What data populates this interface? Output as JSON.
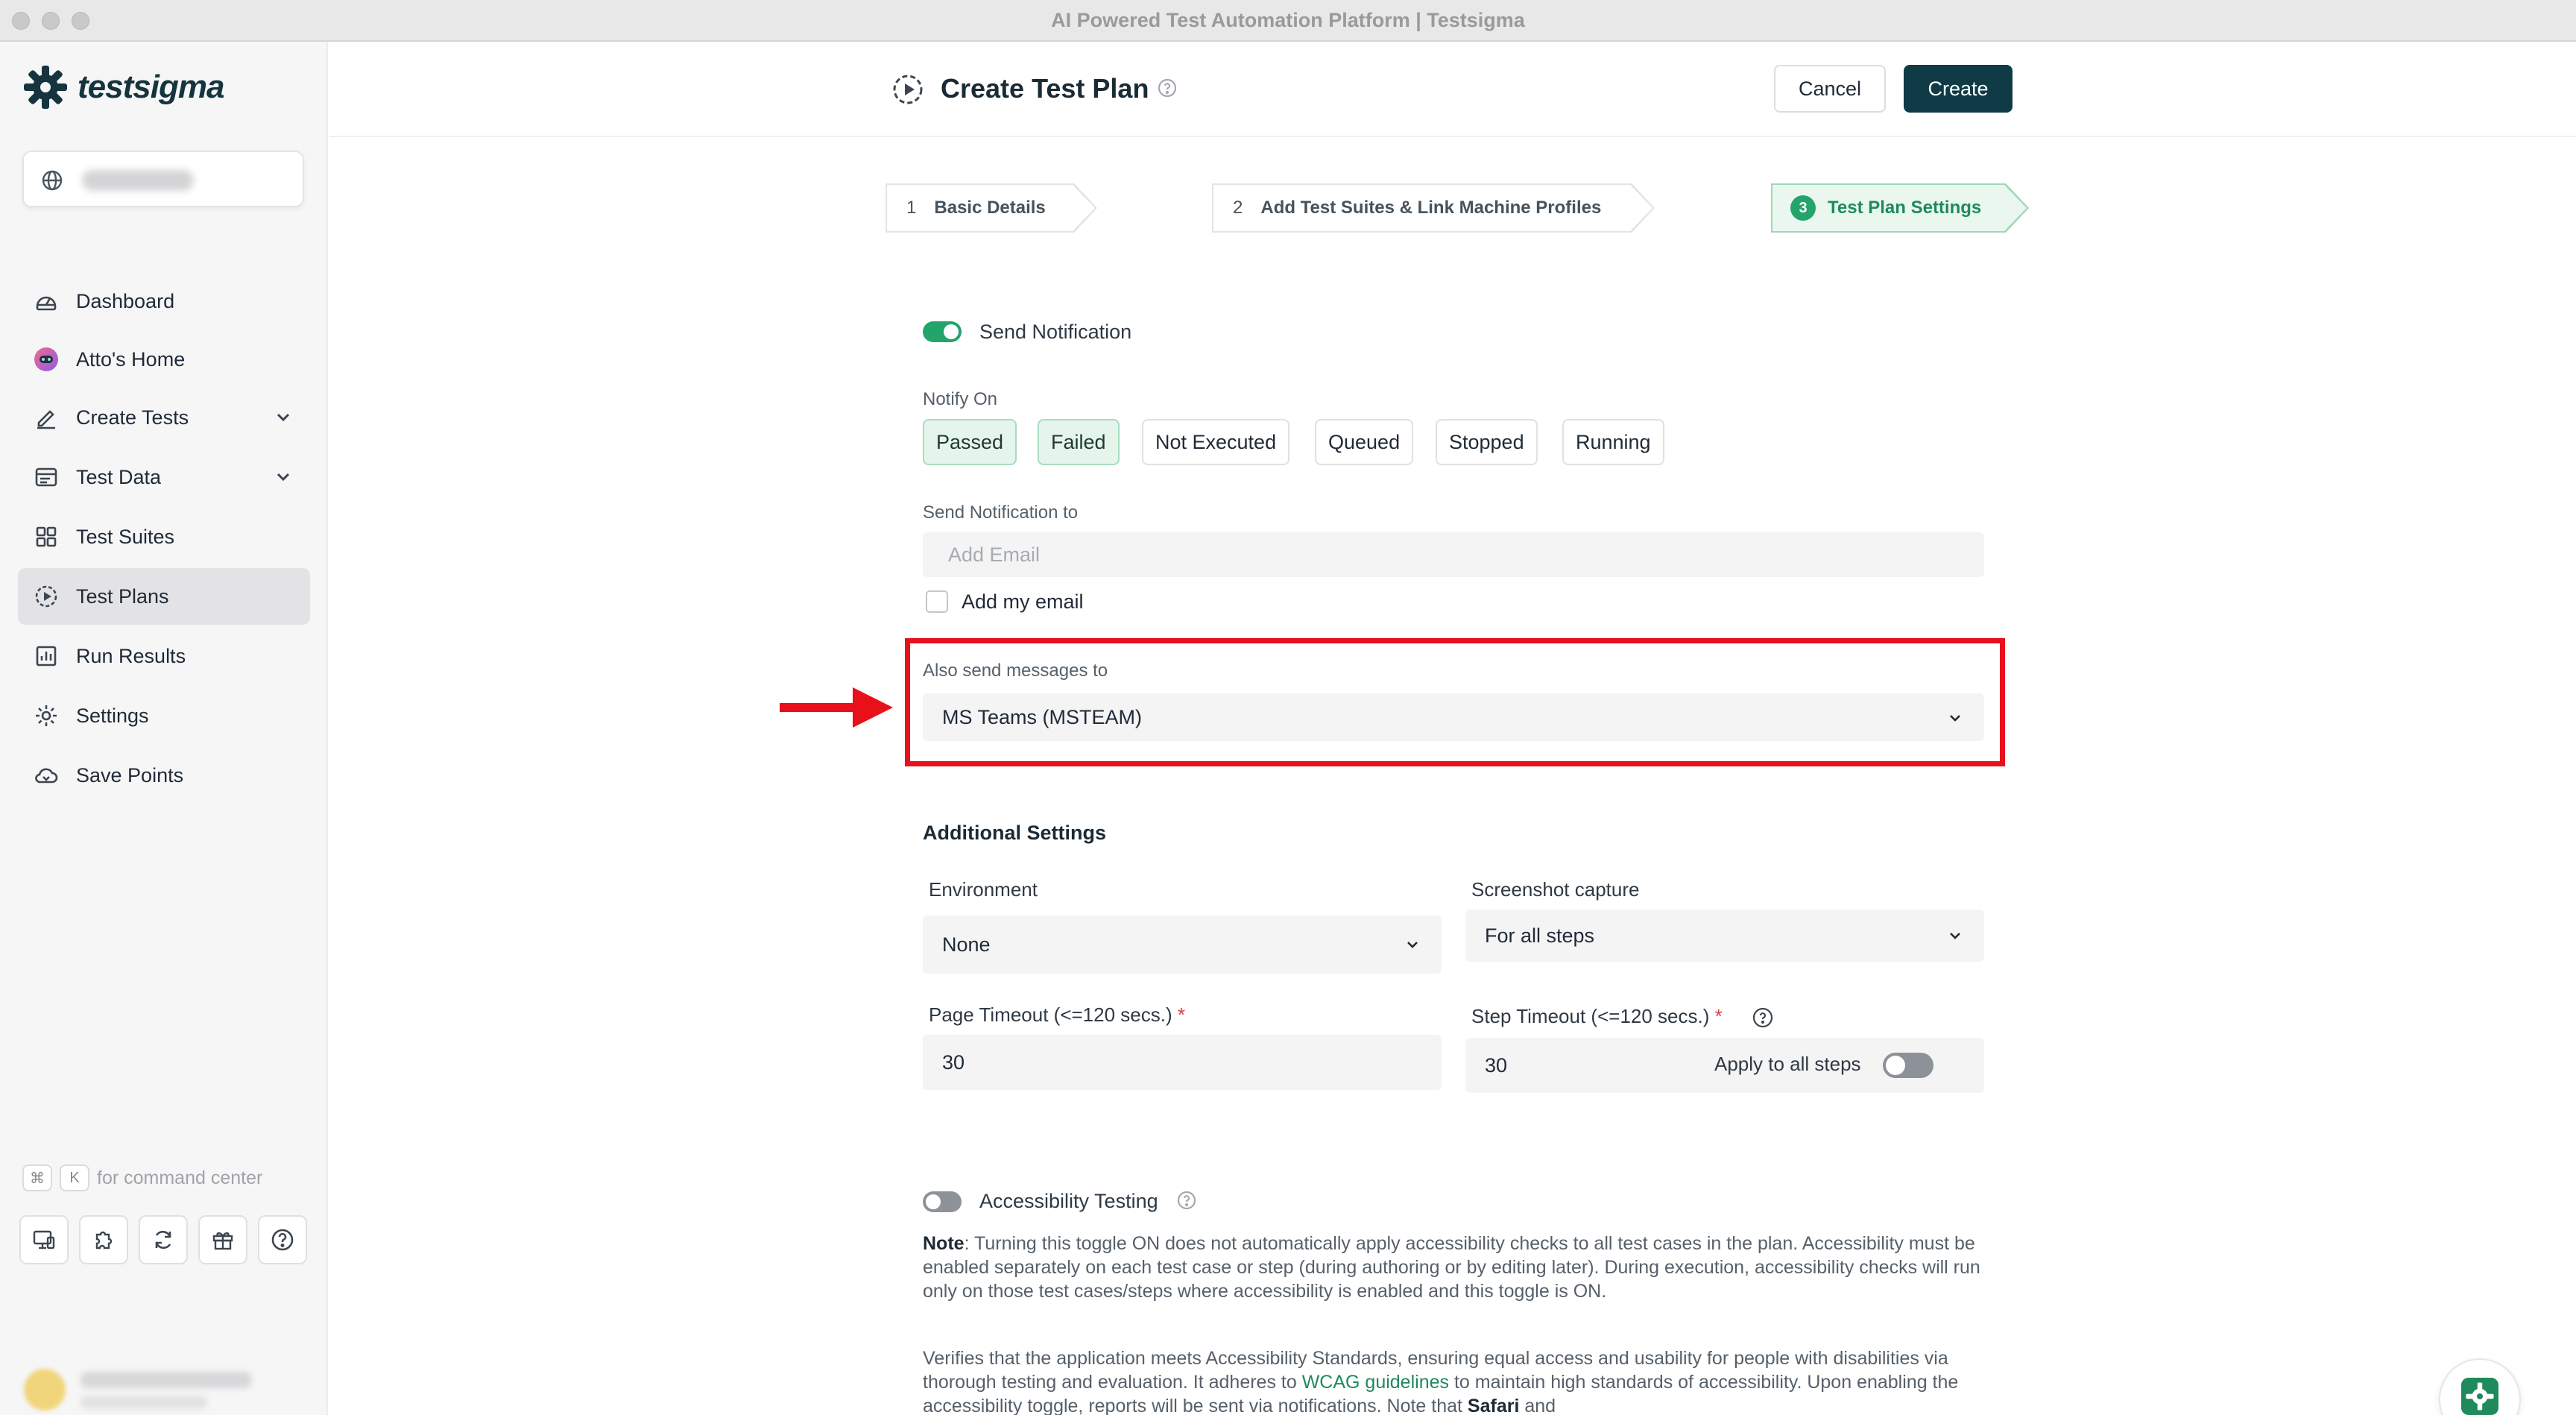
{
  "window": {
    "title": "AI Powered Test Automation Platform | Testsigma"
  },
  "brand": {
    "name": "testsigma",
    "color": "#15343e",
    "accent": "#23a46b",
    "primary_button": "#0e3b45",
    "highlight": "#e8101a"
  },
  "sidebar": {
    "items": [
      {
        "label": "Dashboard",
        "icon": "dashboard-gauge-icon"
      },
      {
        "label": "Atto's Home",
        "icon": "atto-avatar-icon"
      },
      {
        "label": "Create Tests",
        "icon": "pencil-icon",
        "expandable": true
      },
      {
        "label": "Test Data",
        "icon": "data-table-icon",
        "expandable": true
      },
      {
        "label": "Test Suites",
        "icon": "grid-icon"
      },
      {
        "label": "Test Plans",
        "icon": "play-circle-icon",
        "active": true
      },
      {
        "label": "Run Results",
        "icon": "bar-chart-icon"
      },
      {
        "label": "Settings",
        "icon": "gear-icon"
      },
      {
        "label": "Save Points",
        "icon": "cloud-save-icon"
      }
    ],
    "command_hint": {
      "key1": "⌘",
      "key2": "K",
      "text": "for command center"
    },
    "bottom_icons": [
      "monitor-icon",
      "puzzle-icon",
      "sync-icon",
      "gift-icon",
      "help-icon"
    ]
  },
  "header": {
    "title": "Create Test Plan",
    "cancel_label": "Cancel",
    "create_label": "Create"
  },
  "steps": [
    {
      "num": "1",
      "label": "Basic Details"
    },
    {
      "num": "2",
      "label": "Add Test Suites & Link Machine Profiles"
    },
    {
      "num": "3",
      "label": "Test Plan Settings",
      "active": true
    }
  ],
  "notification": {
    "toggle_label": "Send Notification",
    "enabled": true,
    "notify_on_label": "Notify On",
    "chips": [
      {
        "label": "Passed",
        "selected": true
      },
      {
        "label": "Failed",
        "selected": true
      },
      {
        "label": "Not Executed",
        "selected": false
      },
      {
        "label": "Queued",
        "selected": false
      },
      {
        "label": "Stopped",
        "selected": false
      },
      {
        "label": "Running",
        "selected": false
      }
    ],
    "send_to_label": "Send Notification to",
    "email_placeholder": "Add Email",
    "add_my_email_label": "Add my email",
    "also_send_label": "Also send messages to",
    "also_send_value": "MS Teams (MSTEAM)"
  },
  "additional": {
    "title": "Additional Settings",
    "environment_label": "Environment",
    "environment_value": "None",
    "screenshot_label": "Screenshot capture",
    "screenshot_value": "For all steps",
    "page_timeout_label": "Page Timeout (<=120 secs.)",
    "page_timeout_value": "30",
    "step_timeout_label": "Step Timeout (<=120 secs.)",
    "step_timeout_value": "30",
    "apply_all_label": "Apply to all steps",
    "required_mark": "*"
  },
  "accessibility": {
    "toggle_label": "Accessibility Testing",
    "enabled": false,
    "note_bold": "Note",
    "note_text": ": Turning this toggle ON does not automatically apply accessibility checks to all test cases in the plan. Accessibility must be enabled separately on each test case or step (during authoring or by editing later). During execution, accessibility checks will run only on those test cases/steps where accessibility is enabled and this toggle is ON.",
    "para2_a": "Verifies that the application meets Accessibility Standards, ensuring equal access and usability for people with disabilities via thorough testing and evaluation. It adheres to ",
    "para2_link": "WCAG guidelines",
    "para2_b": " to maintain high standards of accessibility. Upon enabling the accessibility toggle, reports will be sent via notifications. Note that ",
    "para2_bold": "Safari",
    "para2_c": " and"
  }
}
